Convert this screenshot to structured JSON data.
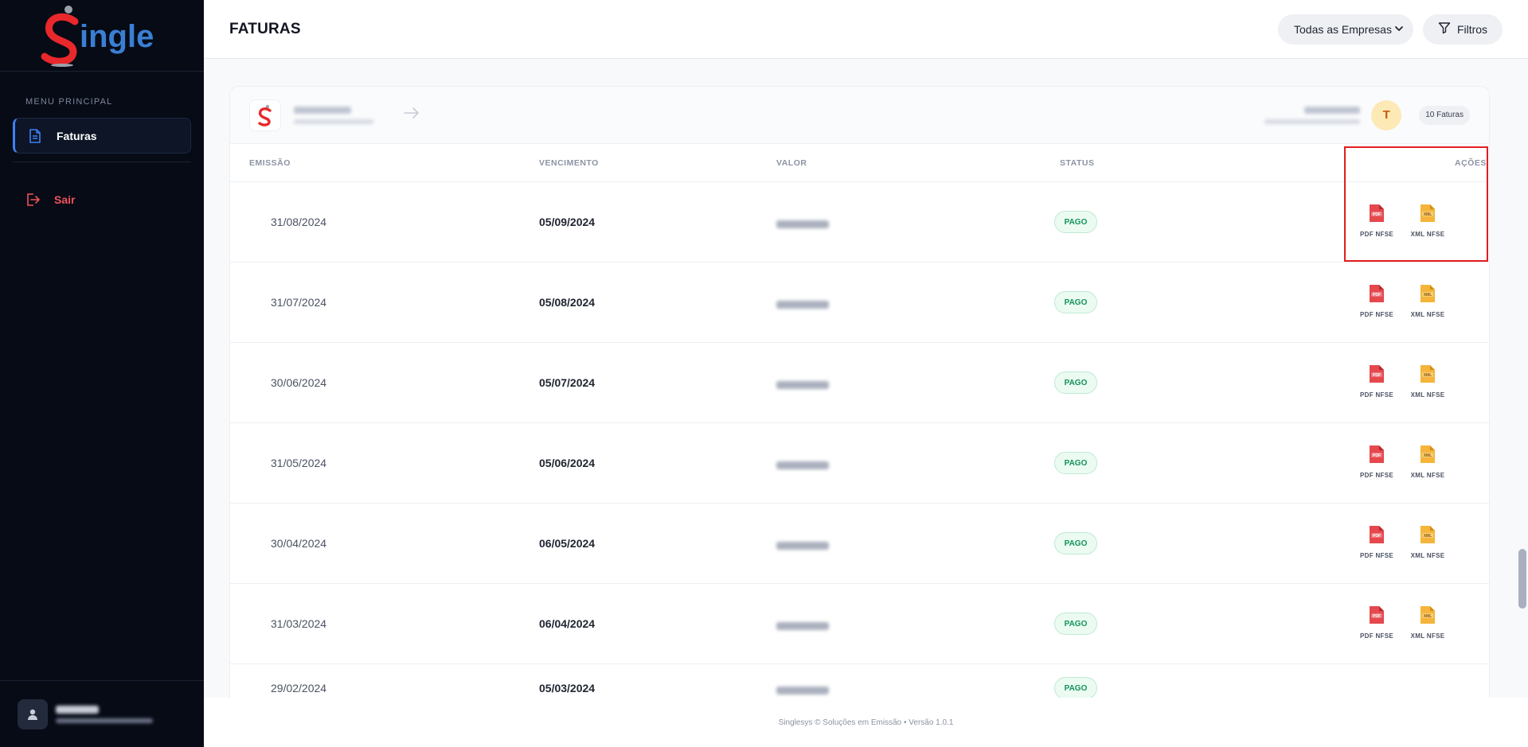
{
  "app": {
    "logo_text": "Single"
  },
  "sidebar": {
    "menu_title": "MENU PRINCIPAL",
    "items": [
      {
        "label": "Faturas",
        "icon": "document-icon"
      },
      {
        "label": "Sair",
        "icon": "logout-icon"
      }
    ],
    "user": {
      "icon": "user-icon"
    }
  },
  "header": {
    "title": "FATURAS",
    "company_select": "Todas as Empresas",
    "filters_label": "Filtros"
  },
  "card": {
    "avatar_initial": "T",
    "count_badge": "10 Faturas"
  },
  "table": {
    "columns": {
      "emissao": "EMISSÃO",
      "vencimento": "VENCIMENTO",
      "valor": "VALOR",
      "status": "STATUS",
      "acoes": "AÇÕES"
    },
    "action_pdf": "PDF NFSE",
    "action_xml": "XML NFSE",
    "rows": [
      {
        "emissao": "31/08/2024",
        "vencimento": "05/09/2024",
        "status": "PAGO"
      },
      {
        "emissao": "31/07/2024",
        "vencimento": "05/08/2024",
        "status": "PAGO"
      },
      {
        "emissao": "30/06/2024",
        "vencimento": "05/07/2024",
        "status": "PAGO"
      },
      {
        "emissao": "31/05/2024",
        "vencimento": "05/06/2024",
        "status": "PAGO"
      },
      {
        "emissao": "30/04/2024",
        "vencimento": "06/05/2024",
        "status": "PAGO"
      },
      {
        "emissao": "31/03/2024",
        "vencimento": "06/04/2024",
        "status": "PAGO"
      },
      {
        "emissao": "29/02/2024",
        "vencimento": "05/03/2024",
        "status": "PAGO"
      }
    ]
  },
  "footer": {
    "text": "Singlesys © Soluções em Emissão • Versão 1.0.1"
  },
  "colors": {
    "accent": "#3b82f6",
    "danger": "#f0515a",
    "success": "#16925a",
    "sidebar_bg": "#070b16",
    "highlight": "#e31d1d"
  }
}
